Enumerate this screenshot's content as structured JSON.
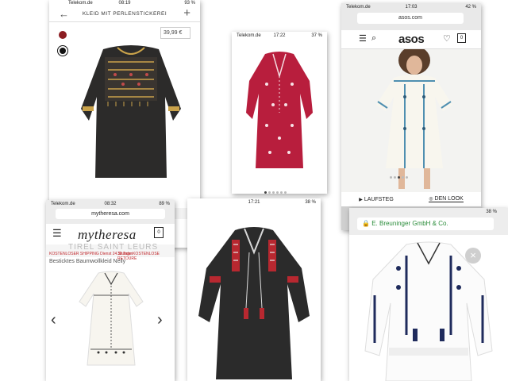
{
  "colors": {
    "accent_dark": "#2b2b2b",
    "dress_red": "#b81e3d",
    "mytheresa_red": "#c0282d",
    "asos_bar": "#e9e9e9",
    "ios_green": "#2a8c3a"
  },
  "screen1": {
    "status": {
      "carrier": "Telekom.de",
      "time": "08:19",
      "battery": "93 %"
    },
    "title": "KLEID MIT PERLENSTICKEREI",
    "back_icon": "arrow-left-icon",
    "add_icon": "plus-icon",
    "price": "39,99 €",
    "swatches": [
      "#8c1d22",
      "#1a1a1a"
    ]
  },
  "screen2": {
    "status": {
      "carrier": "Telekom.de",
      "time": "17:22",
      "battery": "37 %"
    }
  },
  "screen3": {
    "status": {
      "carrier": "Telekom.de",
      "time": "17:03",
      "battery": "42 %"
    },
    "url": "asos.com",
    "logo": "asos",
    "bag_count": "0",
    "buttons": {
      "laufsteg": "LAUFSTEG",
      "den_look": "DEN LOOK"
    }
  },
  "screen4": {
    "status": {
      "carrier": "Telekom.de",
      "time": "08:32",
      "battery": "89 %"
    },
    "url": "mytheresa.com",
    "logo": "mytheresa",
    "bag_count": "0",
    "banner_text": "TIREL SAINT LEURS",
    "shipping_left": "KOSTENLOSER SHIPPING Dienst 24 Stunden",
    "shipping_right": "30 Tage KOSTENLOSE RETOURE",
    "product": "Besticktes Baumwollkleid Nelly"
  },
  "screen5": {
    "status": {
      "time": "17:21",
      "battery": "38 %"
    }
  },
  "screen6": {
    "status": {
      "battery": "38 %"
    },
    "url": "E. Breuninger GmbH & Co."
  }
}
